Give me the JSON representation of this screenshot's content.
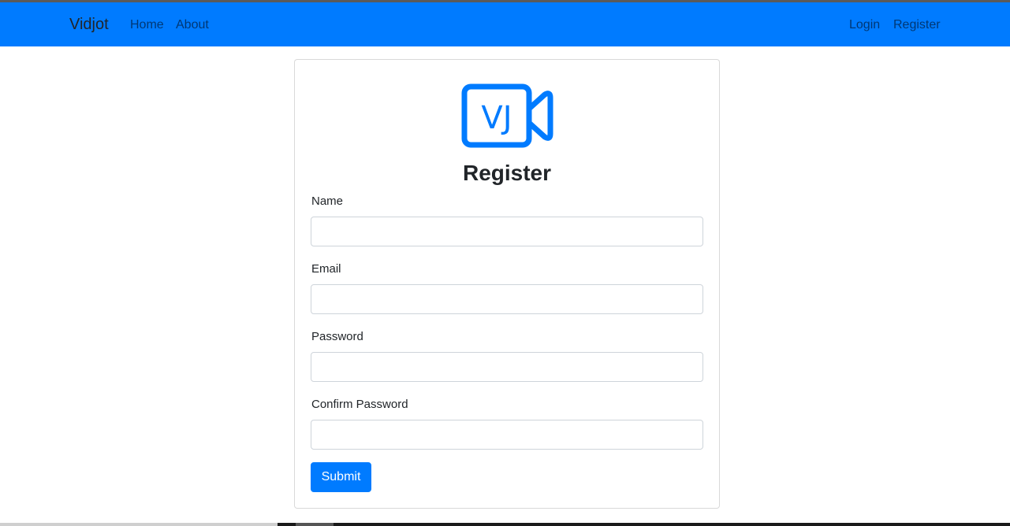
{
  "navbar": {
    "brand": "Vidjot",
    "left_links": [
      "Home",
      "About"
    ],
    "right_links": [
      "Login",
      "Register"
    ]
  },
  "logo": {
    "text": "VJ",
    "icon": "video-camera-icon",
    "color": "#007bff"
  },
  "form": {
    "title": "Register",
    "fields": [
      {
        "label": "Name",
        "value": ""
      },
      {
        "label": "Email",
        "value": ""
      },
      {
        "label": "Password",
        "value": ""
      },
      {
        "label": "Confirm Password",
        "value": ""
      }
    ],
    "submit_label": "Submit"
  },
  "colors": {
    "primary": "#007bff",
    "text": "#212529"
  }
}
